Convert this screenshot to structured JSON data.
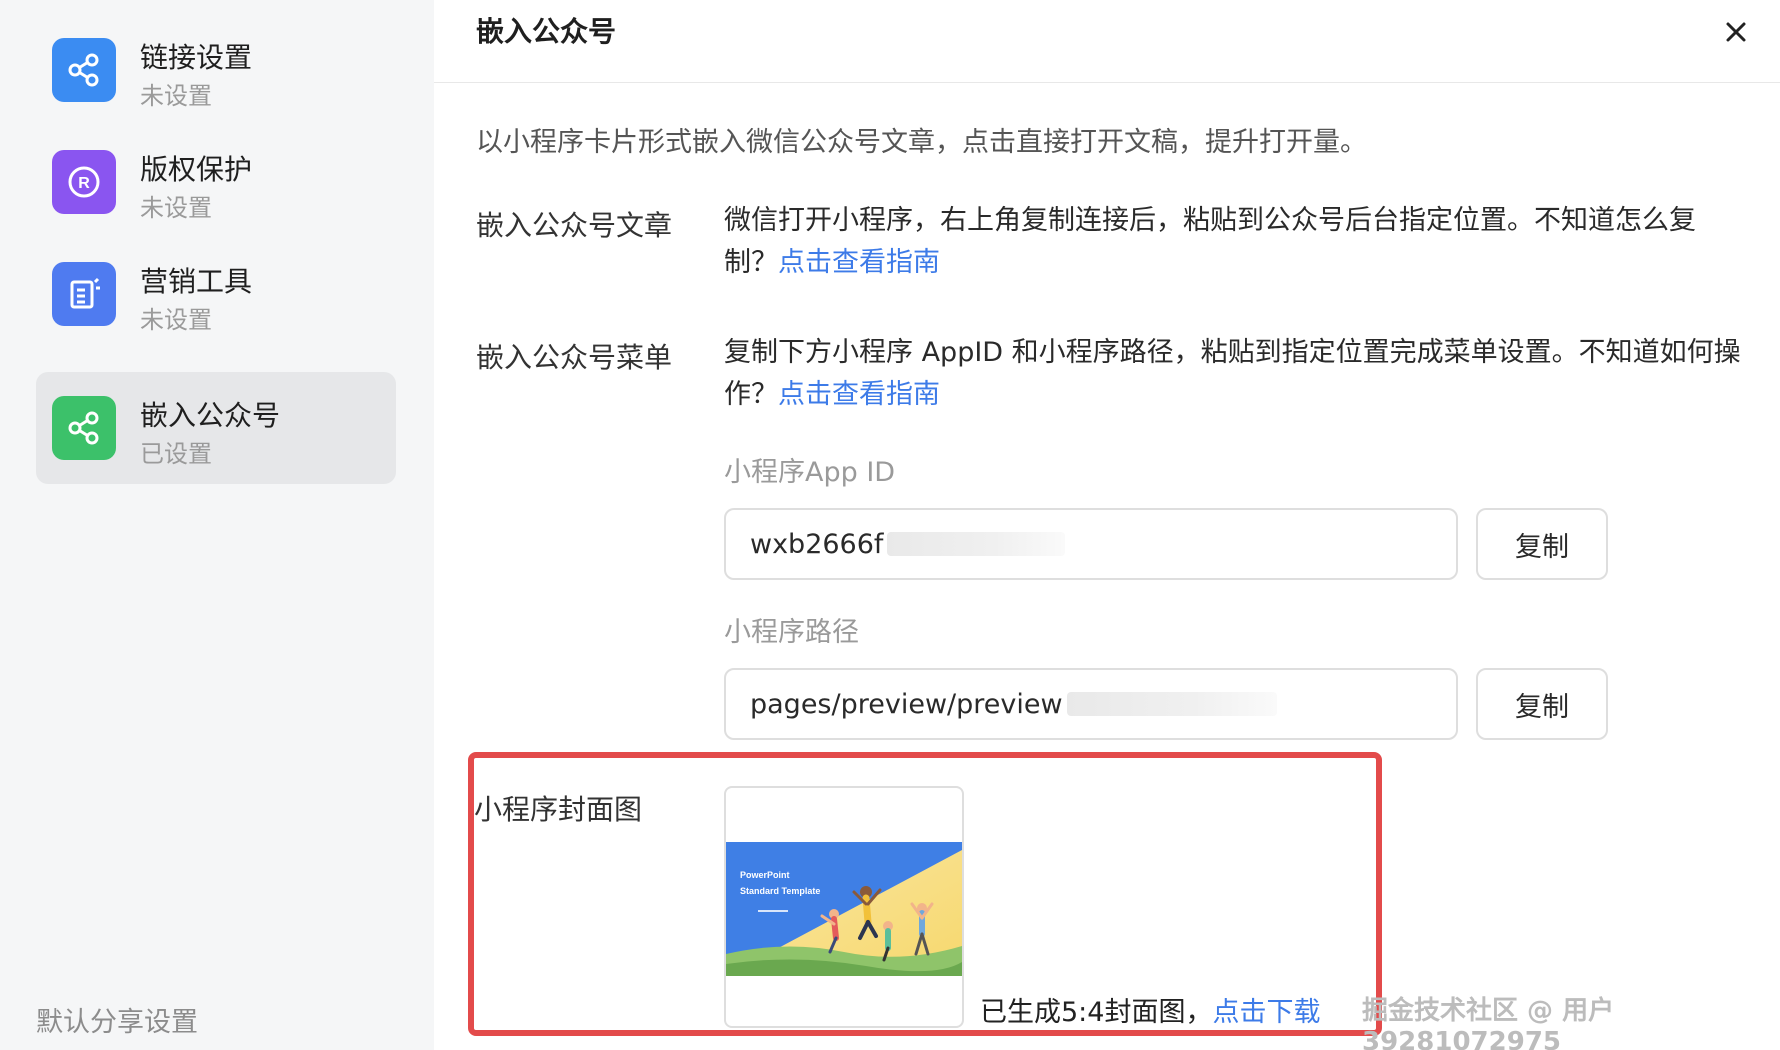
{
  "sidebar": {
    "items": [
      {
        "title": "链接设置",
        "status": "未设置",
        "icon": "share-icon",
        "color": "#3b8cf2"
      },
      {
        "title": "版权保护",
        "status": "未设置",
        "icon": "registered-icon",
        "color": "#8a55f0"
      },
      {
        "title": "营销工具",
        "status": "未设置",
        "icon": "marketing-icon",
        "color": "#4f7bf0"
      },
      {
        "title": "嵌入公众号",
        "status": "已设置",
        "icon": "share-icon",
        "color": "#3cc16a",
        "active": true
      }
    ],
    "footer": "默认分享设置"
  },
  "header": {
    "title": "嵌入公众号",
    "close_icon": "close-icon"
  },
  "intro": "以小程序卡片形式嵌入微信公众号文章，点击直接打开文稿，提升打开量。",
  "article": {
    "label": "嵌入公众号文章",
    "text": "微信打开小程序，右上角复制连接后，粘贴到公众号后台指定位置。不知道怎么复制？",
    "link": "点击查看指南"
  },
  "menu": {
    "label": "嵌入公众号菜单",
    "text": "复制下方小程序 AppID 和小程序路径，粘贴到指定位置完成菜单设置。不知道如何操作？",
    "link": "点击查看指南"
  },
  "app_id": {
    "label": "小程序App ID",
    "value": "wxb2666f",
    "copy_label": "复制"
  },
  "path": {
    "label": "小程序路径",
    "value": "pages/preview/preview",
    "copy_label": "复制"
  },
  "cover": {
    "label": "小程序封面图",
    "thumb_line1": "PowerPoint",
    "thumb_line2": "Standard Template",
    "note": "已生成5:4封面图，",
    "link": "点击下载"
  },
  "watermark": "掘金技术社区 @ 用户39281072975",
  "colors": {
    "accent_link": "#3d7be8",
    "highlight": "#e34b4b"
  }
}
